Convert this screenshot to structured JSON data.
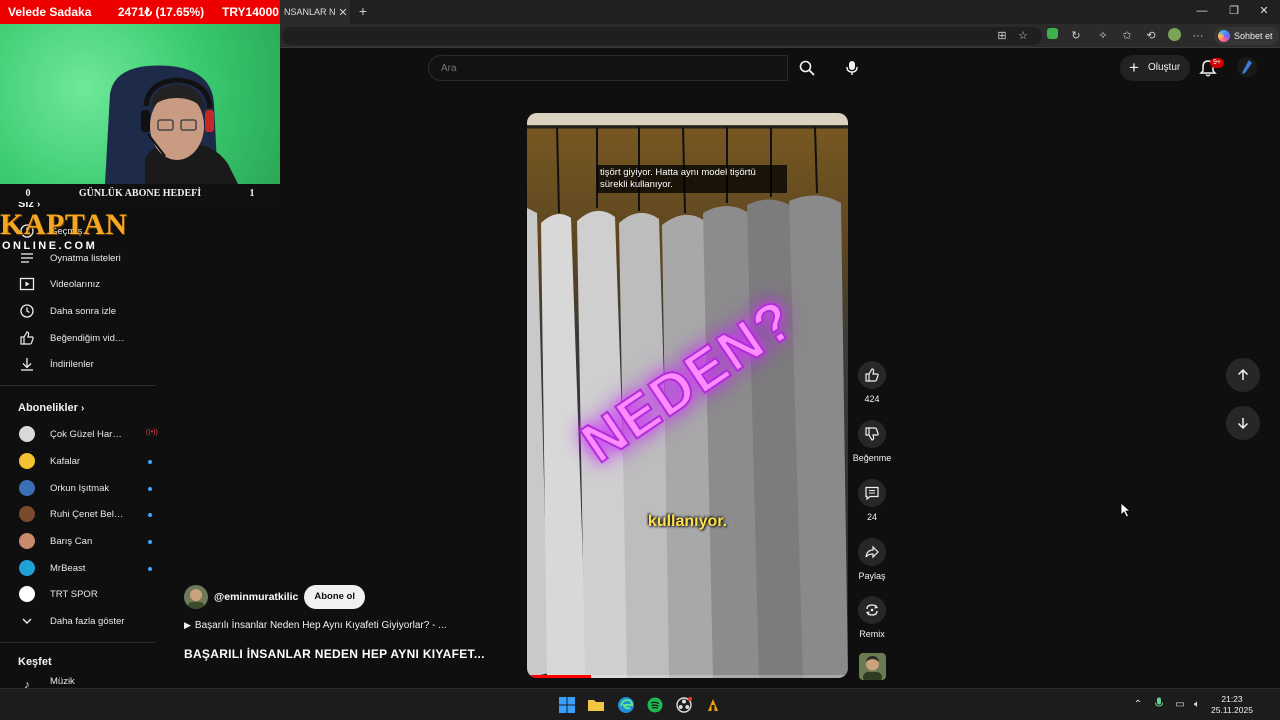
{
  "overlay": {
    "donor": "Velede Sadaka",
    "percent": "2471₺ (17.65%)",
    "goal_amount": "TRY14000",
    "goal_left": "0",
    "goal_label": "GÜNLÜK ABONE HEDEFİ",
    "goal_right": "1",
    "logo_main": "KAPTAN",
    "logo_sub": "ONLINE.COM"
  },
  "browser": {
    "tab_title": "NSANLAR NE",
    "copilot_label": "Sohbet et"
  },
  "header": {
    "search_placeholder": "Ara",
    "create_label": "Oluştur",
    "notification_count": "9+"
  },
  "sidebar": {
    "you_heading": "Siz",
    "you_items": [
      {
        "label": "Geçmiş",
        "icon": "history-icon"
      },
      {
        "label": "Oynatma listeleri",
        "icon": "playlists-icon"
      },
      {
        "label": "Videolarınız",
        "icon": "your-videos-icon"
      },
      {
        "label": "Daha sonra izle",
        "icon": "watch-later-icon"
      },
      {
        "label": "Beğendiğim videolar",
        "icon": "liked-videos-icon"
      },
      {
        "label": "İndirilenler",
        "icon": "downloads-icon"
      }
    ],
    "subs_heading": "Abonelikler",
    "subscriptions": [
      {
        "label": "Çok Güzel Hareket…",
        "color": "#d9d9d9",
        "live": true
      },
      {
        "label": "Kafalar",
        "color": "#f2c230",
        "live": false
      },
      {
        "label": "Orkun Işıtmak",
        "color": "#3d6fb6",
        "live": false
      },
      {
        "label": "Ruhi Çenet Belge…",
        "color": "#7a4a2e",
        "live": false
      },
      {
        "label": "Barış Can",
        "color": "#c98a6b",
        "live": false
      },
      {
        "label": "MrBeast",
        "color": "#1fa3d6",
        "live": false
      },
      {
        "label": "TRT SPOR",
        "color": "#ffffff",
        "live": false
      }
    ],
    "show_more": "Daha fazla göster",
    "explore_heading": "Keşfet",
    "explore_first": "Müzik"
  },
  "short": {
    "caption_top": "tişört giyiyor. Hatta aynı model tişörtü sürekli kullanıyor.",
    "overlay_word": "NEDEN?",
    "caption_bottom": "kullanıyor.",
    "channel": "@eminmuratkilic",
    "subscribe_label": "Abone ol",
    "related_link": "Başarılı İnsanlar Neden Hep Aynı Kıyafeti Giyiyorlar? - ...",
    "title": "BAŞARILI İNSANLAR NEDEN HEP AYNI KIYAFET...",
    "progress": 0.2
  },
  "actions": {
    "likes": "424",
    "dislike_label": "Beğenme",
    "comments": "24",
    "share_label": "Paylaş",
    "remix_label": "Remix"
  },
  "taskbar": {
    "time": "21:23",
    "date": "25.11.2025"
  }
}
